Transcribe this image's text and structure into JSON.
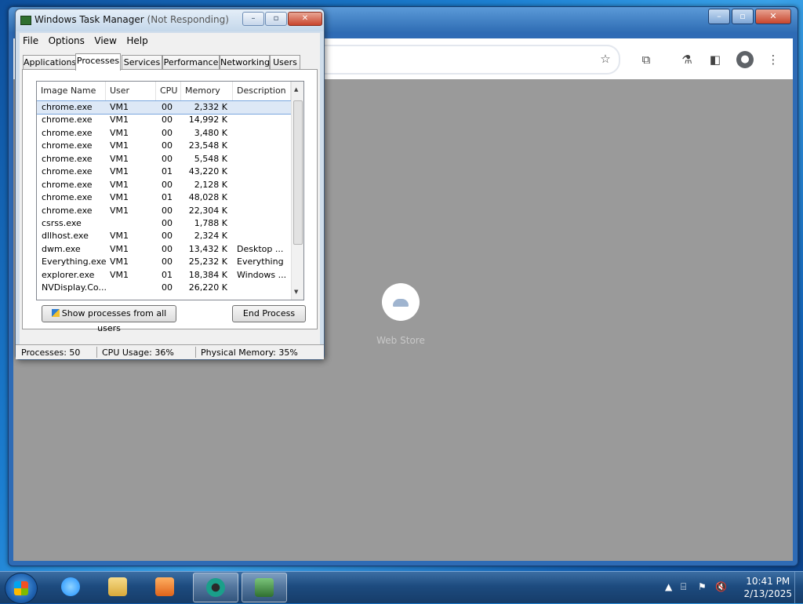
{
  "chrome": {
    "content": {
      "webstore_label": "Web Store"
    }
  },
  "taskmanager": {
    "title": "Windows Task Manager",
    "title_suffix": "(Not Responding)",
    "menu": [
      "File",
      "Options",
      "View",
      "Help"
    ],
    "tabs": [
      "Applications",
      "Processes",
      "Services",
      "Performance",
      "Networking",
      "Users"
    ],
    "active_tab": "Processes",
    "columns": [
      "Image Name",
      "User Name",
      "CPU",
      "Memory (...",
      "Description"
    ],
    "rows": [
      {
        "name": "chrome.exe",
        "user": "VM1",
        "cpu": "00",
        "mem": "2,332 K",
        "desc": ""
      },
      {
        "name": "chrome.exe",
        "user": "VM1",
        "cpu": "00",
        "mem": "14,992 K",
        "desc": ""
      },
      {
        "name": "chrome.exe",
        "user": "VM1",
        "cpu": "00",
        "mem": "3,480 K",
        "desc": ""
      },
      {
        "name": "chrome.exe",
        "user": "VM1",
        "cpu": "00",
        "mem": "23,548 K",
        "desc": ""
      },
      {
        "name": "chrome.exe",
        "user": "VM1",
        "cpu": "00",
        "mem": "5,548 K",
        "desc": ""
      },
      {
        "name": "chrome.exe",
        "user": "VM1",
        "cpu": "01",
        "mem": "43,220 K",
        "desc": ""
      },
      {
        "name": "chrome.exe",
        "user": "VM1",
        "cpu": "00",
        "mem": "2,128 K",
        "desc": ""
      },
      {
        "name": "chrome.exe",
        "user": "VM1",
        "cpu": "01",
        "mem": "48,028 K",
        "desc": ""
      },
      {
        "name": "chrome.exe",
        "user": "VM1",
        "cpu": "00",
        "mem": "22,304 K",
        "desc": ""
      },
      {
        "name": "csrss.exe",
        "user": "",
        "cpu": "00",
        "mem": "1,788 K",
        "desc": ""
      },
      {
        "name": "dllhost.exe",
        "user": "VM1",
        "cpu": "00",
        "mem": "2,324 K",
        "desc": ""
      },
      {
        "name": "dwm.exe",
        "user": "VM1",
        "cpu": "00",
        "mem": "13,432 K",
        "desc": "Desktop ..."
      },
      {
        "name": "Everything.exe",
        "user": "VM1",
        "cpu": "00",
        "mem": "25,232 K",
        "desc": "Everything"
      },
      {
        "name": "explorer.exe",
        "user": "VM1",
        "cpu": "01",
        "mem": "18,384 K",
        "desc": "Windows ..."
      },
      {
        "name": "NVDisplay.Co...",
        "user": "",
        "cpu": "00",
        "mem": "26,220 K",
        "desc": ""
      }
    ],
    "selected_row": 0,
    "show_all_button": "Show processes from all users",
    "end_process_button": "End Process",
    "status": {
      "processes": "Processes: 50",
      "cpu": "CPU Usage: 36%",
      "memory": "Physical Memory: 35%"
    }
  },
  "taskbar": {
    "items": [
      {
        "name": "internet-explorer",
        "color": "#1e90ff"
      },
      {
        "name": "file-explorer",
        "color": "#e8c25a"
      },
      {
        "name": "media-player",
        "color": "#f08a24"
      },
      {
        "name": "chrome",
        "color": "#1a9f8a"
      },
      {
        "name": "task-manager",
        "color": "#3c8a3c"
      }
    ],
    "clock_time": "10:41 PM",
    "clock_date": "2/13/2025"
  }
}
